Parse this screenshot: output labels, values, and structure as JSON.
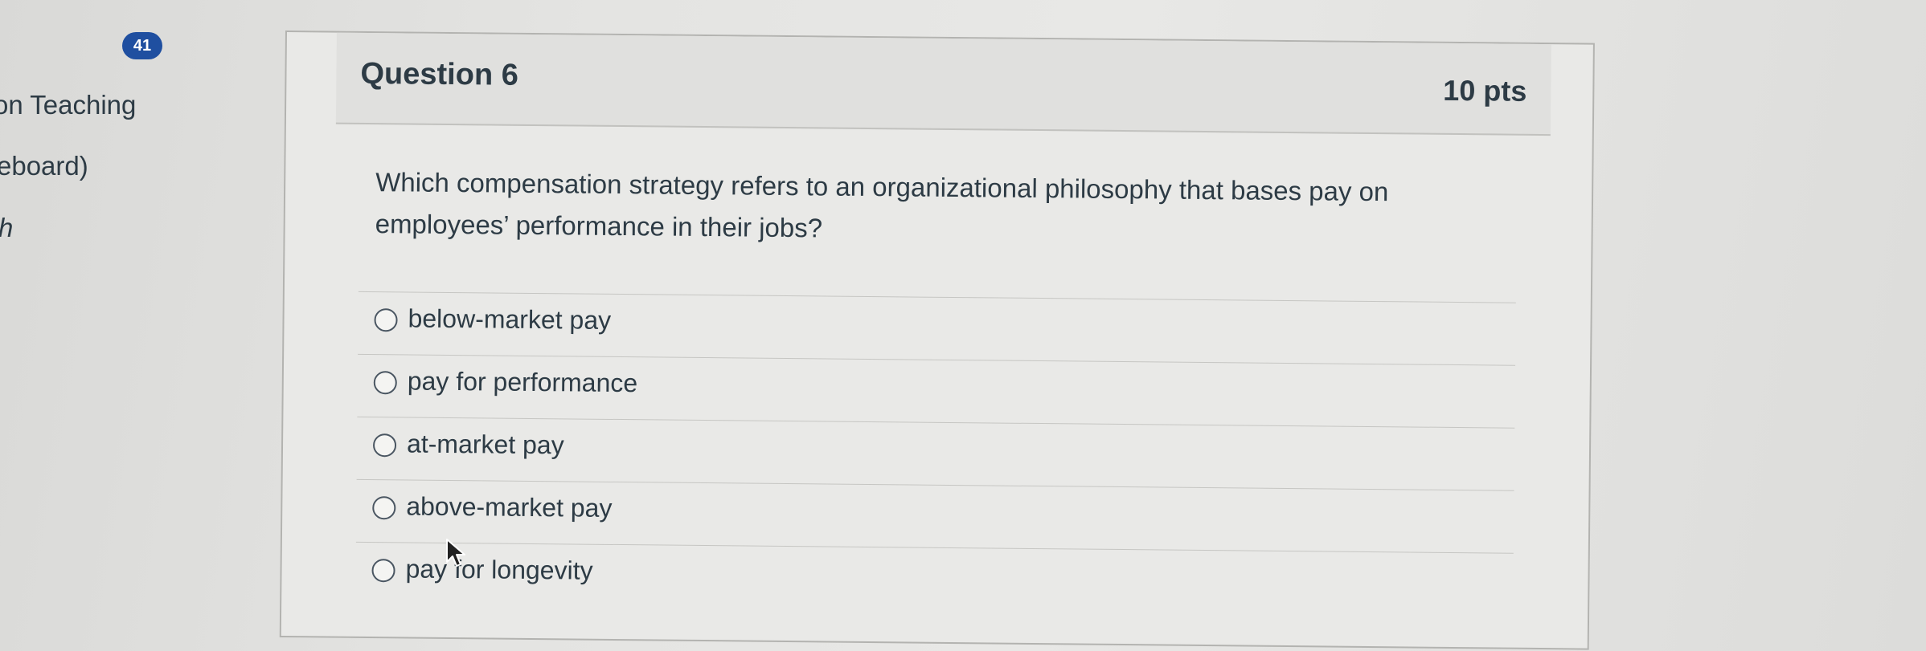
{
  "sidebar": {
    "badge_count": "41",
    "links": [
      "on Teaching",
      "eboard)",
      "h"
    ]
  },
  "question": {
    "title": "Question 6",
    "points": "10 pts",
    "text": "Which compensation strategy refers to an organizational philosophy that bases pay on employees’ performance in their jobs?",
    "answers": [
      {
        "label": "below-market pay"
      },
      {
        "label": "pay for performance"
      },
      {
        "label": "at-market pay"
      },
      {
        "label": "above-market pay"
      },
      {
        "label": "pay for longevity"
      }
    ]
  }
}
